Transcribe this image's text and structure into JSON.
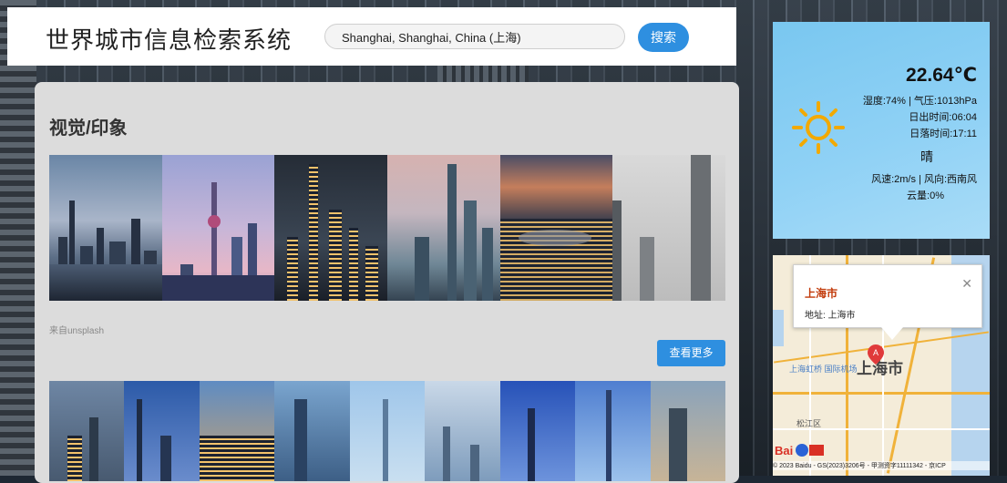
{
  "header": {
    "app_title": "世界城市信息检索系统",
    "search_value": "Shanghai, Shanghai, China (上海)",
    "search_button": "搜索"
  },
  "visual": {
    "title": "视觉/印象",
    "source": "来自unsplash",
    "more_button": "查看更多",
    "gallery_top_count": 6,
    "gallery_bottom_count": 9
  },
  "weather": {
    "temperature": "22.64℃",
    "humidity_pressure": "湿度:74% | 气压:1013hPa",
    "sunrise": "日出时间:06:04",
    "sunset": "日落时间:17:11",
    "condition": "晴",
    "wind": "风速:2m/s | 风向:西南风",
    "cloud": "云量:0%",
    "icon": "sun-icon"
  },
  "map": {
    "popup_title": "上海市",
    "popup_address": "地址:  上海市",
    "marker_label": "A",
    "city_label": "上海市",
    "airport_label": "上海虹桥 国际机场",
    "district_label": "松江区",
    "copyright": "© 2023 Baidu - GS(2023)3206号 - 甲测资字11111342 - 京ICP"
  }
}
